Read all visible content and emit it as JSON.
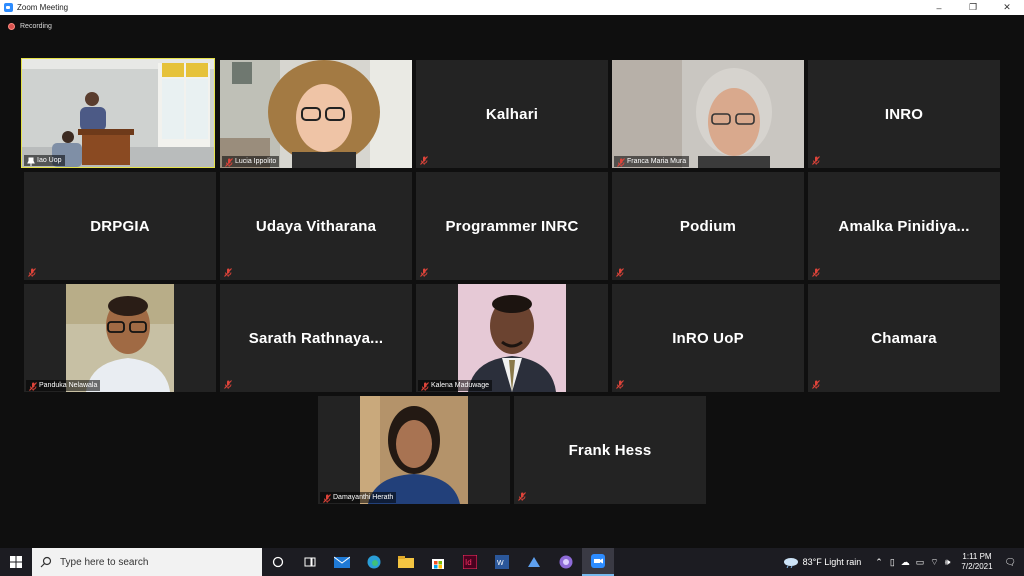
{
  "window": {
    "title": "Zoom Meeting",
    "controls": [
      "–",
      "❐",
      "✕"
    ]
  },
  "recording": {
    "label": "Recording"
  },
  "participants": [
    {
      "name": "Iao Uop",
      "video": true,
      "active": true
    },
    {
      "name": "Lucia Ippolito",
      "video": true
    },
    {
      "name": "Kalhari",
      "video": false
    },
    {
      "name": "Franca Maria Mura",
      "video": true
    },
    {
      "name": "INRO",
      "video": false
    },
    {
      "name": "DRPGIA",
      "video": false
    },
    {
      "name": "Udaya Vitharana",
      "video": false
    },
    {
      "name": "Programmer INRC",
      "video": false
    },
    {
      "name": "Podium",
      "video": false
    },
    {
      "name": "Amalka  Pinidiya...",
      "video": false
    },
    {
      "name": "Panduka Nelawala",
      "video": true
    },
    {
      "name": "Sarath  Rathnaya...",
      "video": false
    },
    {
      "name": "Kalena Maduwage",
      "video": true
    },
    {
      "name": "InRO UoP",
      "video": false
    },
    {
      "name": "Chamara",
      "video": false
    },
    {
      "name": "Damayanthi Herath",
      "video": true
    },
    {
      "name": "Frank Hess",
      "video": false
    }
  ],
  "taskbar": {
    "search_placeholder": "Type here to search",
    "apps": [
      "task-view",
      "mail",
      "edge",
      "file-explorer",
      "store",
      "indesign",
      "word",
      "azure",
      "browser",
      "zoom"
    ],
    "weather": "83°F  Light rain",
    "time": "1:11 PM",
    "date": "7/2/2021"
  },
  "colors": {
    "active_speaker": "#e5e24a",
    "mute": "#e0443a",
    "tile_bg": "#232323",
    "app_bg": "#0f0f0f"
  }
}
